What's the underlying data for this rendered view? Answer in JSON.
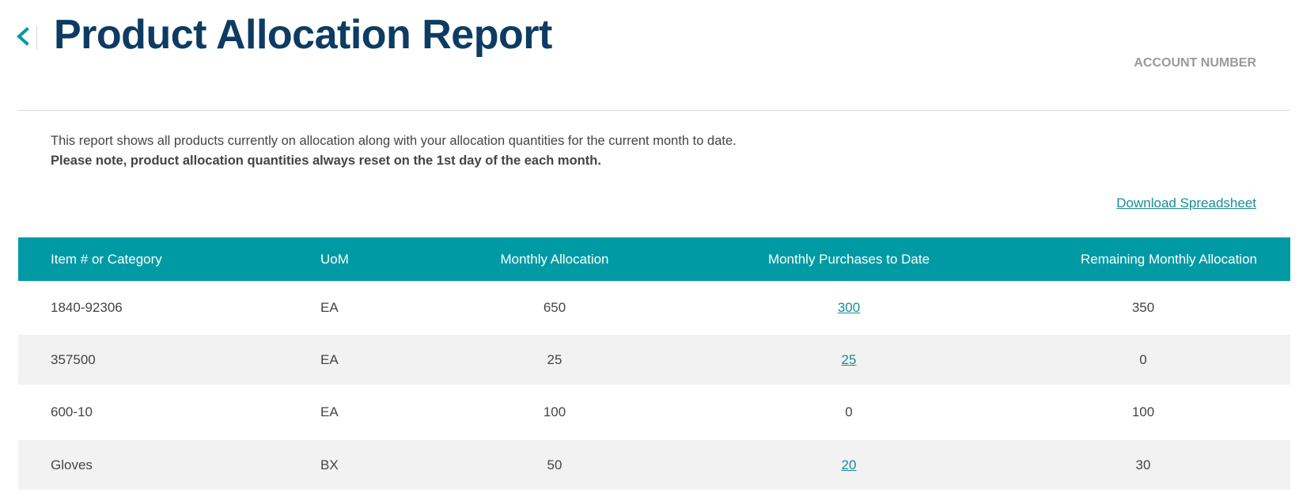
{
  "header": {
    "title": "Product Allocation Report",
    "account_label": "ACCOUNT NUMBER",
    "back_icon": "chevron-left-icon"
  },
  "intro": {
    "description": "This report shows all products currently on allocation along with your allocation quantities for the current month to date.",
    "note": "Please note, product allocation quantities always reset on the 1st day of the each month."
  },
  "actions": {
    "download_label": "Download Spreadsheet"
  },
  "table": {
    "columns": [
      "Item # or Category",
      "UoM",
      "Monthly Allocation",
      "Monthly Purchases to Date",
      "Remaining Monthly Allocation"
    ],
    "rows": [
      {
        "item": "1840-92306",
        "uom": "EA",
        "allocation": "650",
        "purchases": "300",
        "remaining": "350"
      },
      {
        "item": "357500",
        "uom": "EA",
        "allocation": "25",
        "purchases": "25",
        "remaining": "0"
      },
      {
        "item": "600-10",
        "uom": "EA",
        "allocation": "100",
        "purchases": "0",
        "remaining": "100"
      },
      {
        "item": "Gloves",
        "uom": "BX",
        "allocation": "50",
        "purchases": "20",
        "remaining": "30"
      }
    ]
  },
  "colors": {
    "title": "#0d3b63",
    "accent": "#009aa5",
    "link": "#1a8c96",
    "row_alt": "#f2f2f2"
  }
}
